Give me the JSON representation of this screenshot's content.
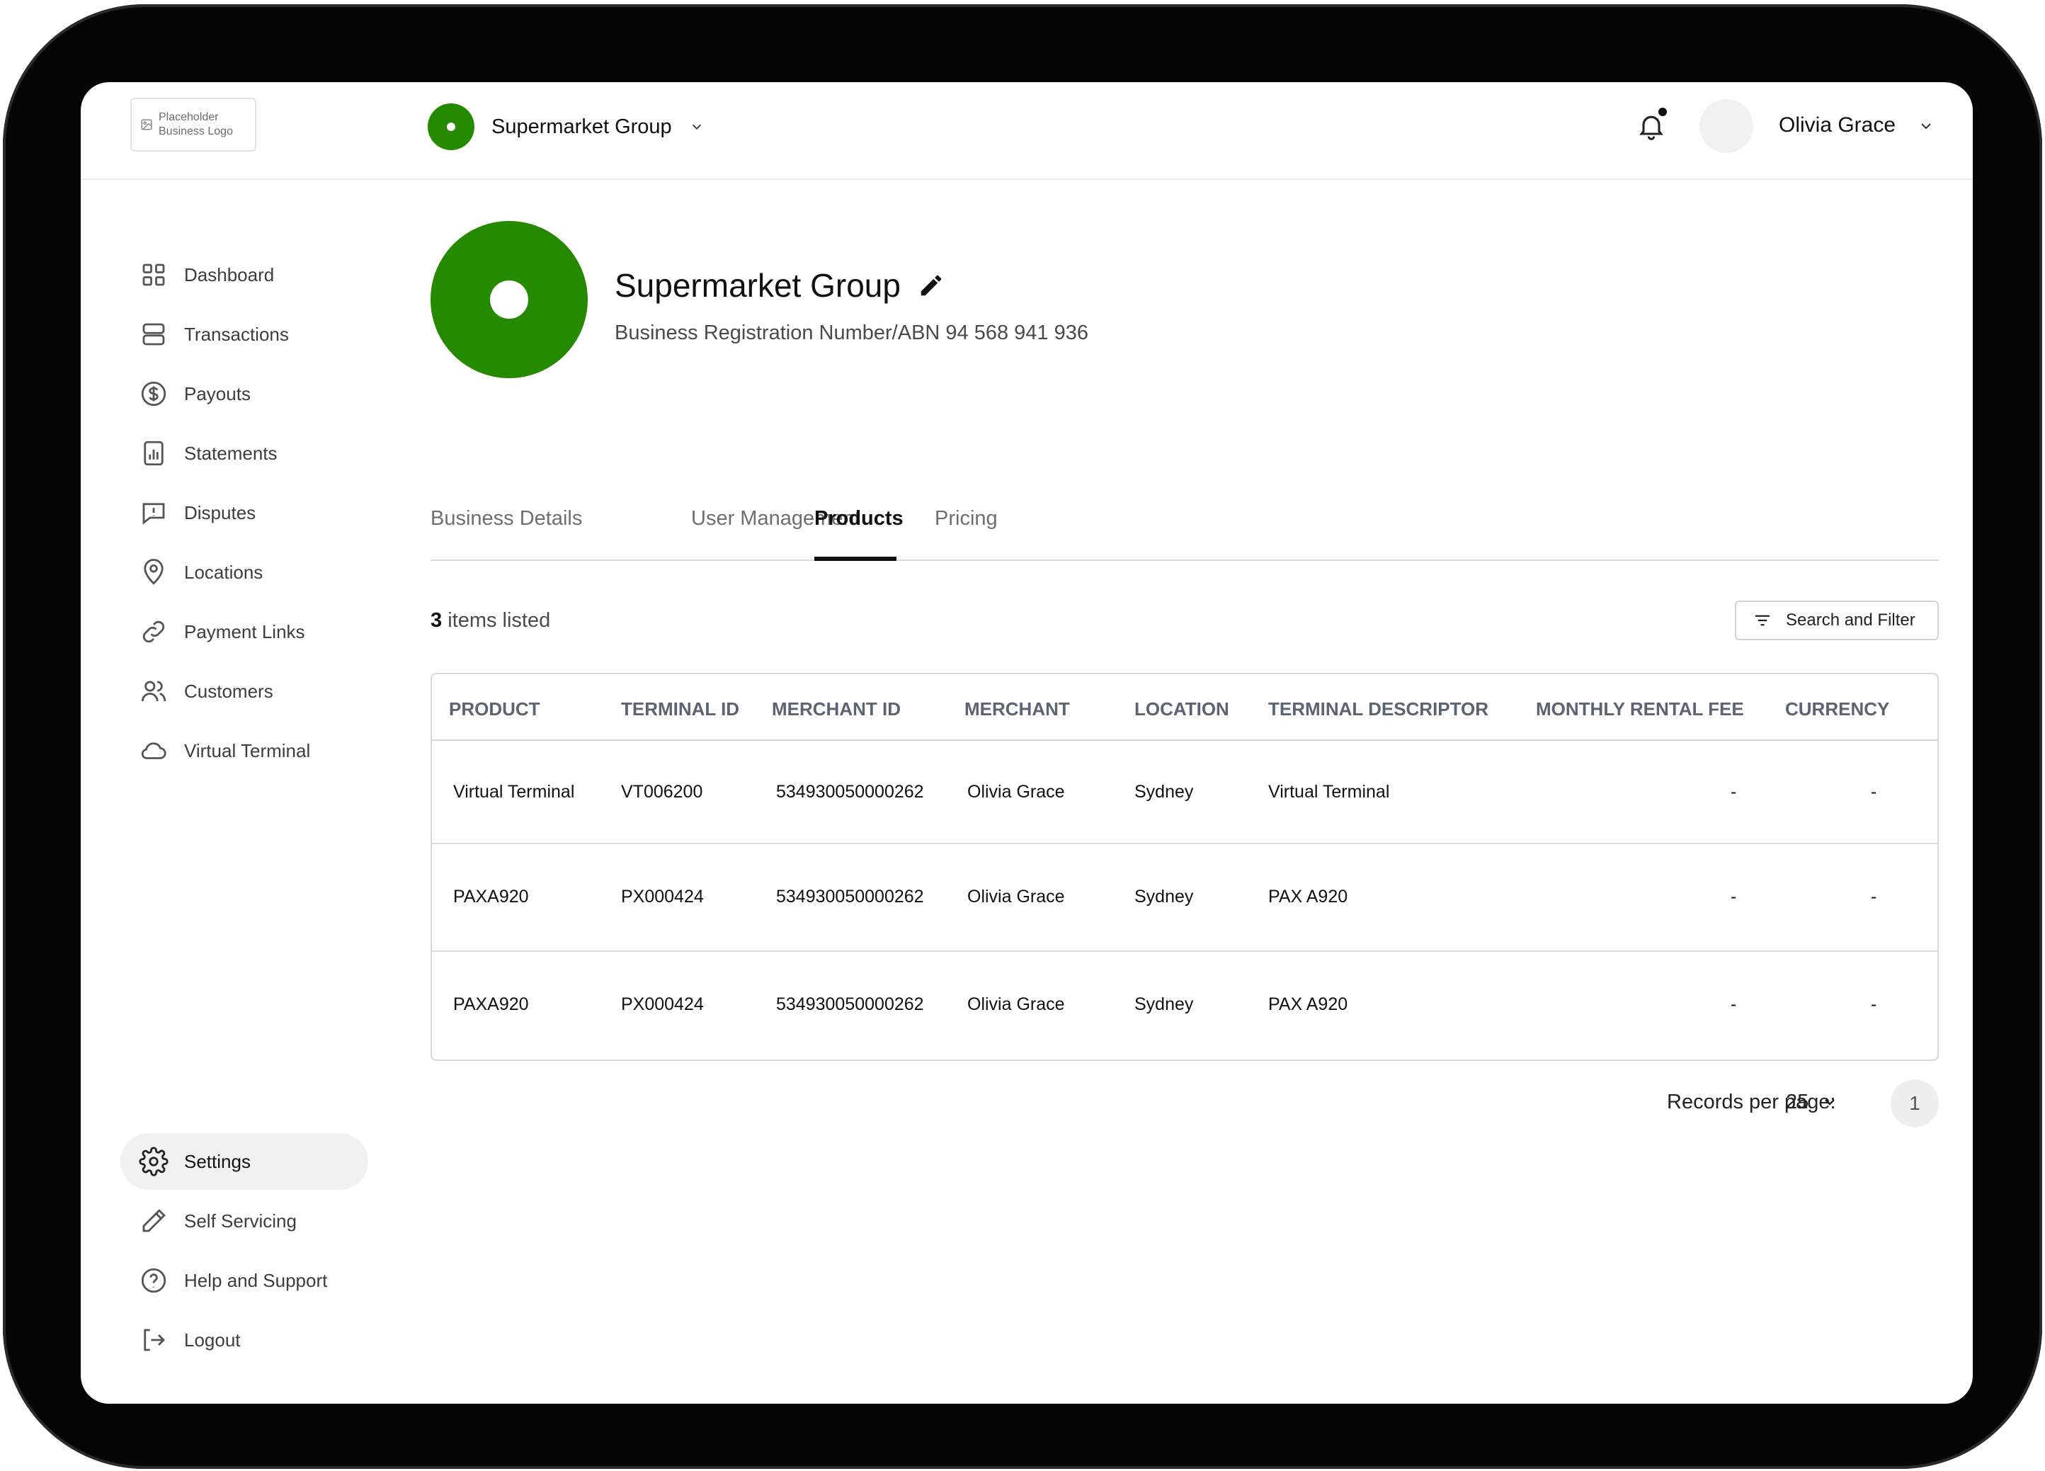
{
  "header": {
    "logo_text": "Placeholder Business Logo",
    "org_name": "Supermarket Group",
    "user_name": "Olivia Grace"
  },
  "sidebar": {
    "items": [
      {
        "label": "Dashboard",
        "icon": "grid-icon"
      },
      {
        "label": "Transactions",
        "icon": "layers-icon"
      },
      {
        "label": "Payouts",
        "icon": "dollar-circle-icon"
      },
      {
        "label": "Statements",
        "icon": "bar-chart-doc-icon"
      },
      {
        "label": "Disputes",
        "icon": "alert-message-icon"
      },
      {
        "label": "Locations",
        "icon": "map-pin-icon"
      },
      {
        "label": "Payment Links",
        "icon": "link-icon"
      },
      {
        "label": "Customers",
        "icon": "users-icon"
      },
      {
        "label": "Virtual Terminal",
        "icon": "cloud-icon"
      }
    ],
    "bottom_items": [
      {
        "label": "Settings",
        "icon": "gear-icon",
        "active": true
      },
      {
        "label": "Self Servicing",
        "icon": "pencil-icon"
      },
      {
        "label": "Help and Support",
        "icon": "help-circle-icon"
      },
      {
        "label": "Logout",
        "icon": "logout-icon"
      }
    ]
  },
  "business": {
    "name": "Supermarket Group",
    "abn": "Business Registration Number/ABN 94 568 941 936"
  },
  "tabs": [
    {
      "label": "Business Details"
    },
    {
      "label": "User Management"
    },
    {
      "label": "Products",
      "active": true
    },
    {
      "label": "Pricing"
    }
  ],
  "list": {
    "count": "3",
    "count_suffix": " items listed",
    "filter_label": "Search and Filter"
  },
  "table": {
    "columns": [
      "PRODUCT",
      "TERMINAL ID",
      "MERCHANT ID",
      "MERCHANT",
      "LOCATION",
      "TERMINAL DESCRIPTOR",
      "MONTHLY RENTAL FEE",
      "CURRENCY"
    ],
    "rows": [
      {
        "product": "Virtual Terminal",
        "terminal_id": "VT006200",
        "merchant_id": "534930050000262",
        "merchant": "Olivia Grace",
        "location": "Sydney",
        "descriptor": "Virtual Terminal",
        "fee": "-",
        "currency": "-"
      },
      {
        "product": "PAXA920",
        "terminal_id": "PX000424",
        "merchant_id": "534930050000262",
        "merchant": "Olivia Grace",
        "location": "Sydney",
        "descriptor": "PAX A920",
        "fee": "-",
        "currency": "-"
      },
      {
        "product": "PAXA920",
        "terminal_id": "PX000424",
        "merchant_id": "534930050000262",
        "merchant": "Olivia Grace",
        "location": "Sydney",
        "descriptor": "PAX A920",
        "fee": "-",
        "currency": "-"
      }
    ]
  },
  "pagination": {
    "records_label": "Records per page:",
    "records_value": "25",
    "current_page": "1"
  },
  "colors": {
    "brand_green": "#258a00",
    "active_nav_bg": "#f1f1f1"
  }
}
